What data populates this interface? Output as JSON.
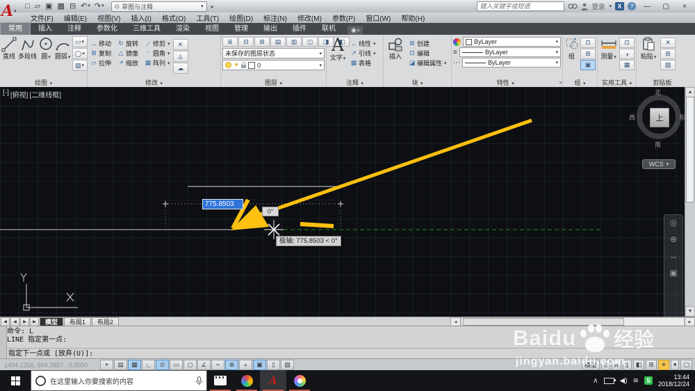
{
  "colors": {
    "acadred": "#c01b1b",
    "sel": "#2f73d8",
    "arrow": "#ffc010",
    "polar": "#1e8f1e"
  },
  "glyphs": {
    "caret": "▾",
    "expander": "»"
  },
  "titlebar": {
    "logo": "A",
    "logo_caret": "▾",
    "qat": [
      {
        "g": "□",
        "name": "new-file-button"
      },
      {
        "g": "▱",
        "name": "open-file-button"
      },
      {
        "g": "▣",
        "name": "save-button"
      },
      {
        "g": "▩",
        "name": "save-as-button"
      },
      {
        "g": "⊟",
        "name": "plot-button"
      },
      {
        "g": "↶",
        "dd": "▾",
        "name": "undo-button"
      },
      {
        "g": "↷",
        "dd": "▾",
        "name": "redo-button"
      }
    ],
    "workspace": {
      "gear": "⊙",
      "label": "草图与注释",
      "caret": "▾"
    },
    "expand": "▸",
    "search_placeholder": "键入关键字或短语",
    "signin": "登录",
    "signin_caret": "▾",
    "exchange": "X",
    "help": "?",
    "win": {
      "min": "—",
      "max": "▢",
      "close": "×"
    }
  },
  "menubar": {
    "items": [
      "文件(F)",
      "编辑(E)",
      "视图(V)",
      "插入(I)",
      "格式(O)",
      "工具(T)",
      "绘图(D)",
      "标注(N)",
      "修改(M)",
      "参数(P)",
      "窗口(W)",
      "帮助(H)"
    ]
  },
  "ribbon": {
    "tabs": [
      {
        "label": "常用",
        "active": true
      },
      {
        "label": "插入"
      },
      {
        "label": "注释"
      },
      {
        "label": "参数化"
      },
      {
        "label": "三维工具"
      },
      {
        "label": "渲染"
      },
      {
        "label": "视图"
      },
      {
        "label": "管理"
      },
      {
        "label": "输出"
      },
      {
        "label": "插件"
      },
      {
        "label": "联机"
      }
    ],
    "extra": {
      "g": "◉",
      "dd": "▾"
    },
    "draw": {
      "title": "绘图",
      "caret": "▾",
      "tools": [
        {
          "label": "直线"
        },
        {
          "label": "多段线"
        },
        {
          "label": "圆",
          "dd": "▾"
        },
        {
          "label": "圆弧",
          "dd": "▾"
        }
      ],
      "side": [
        {
          "g": "▭",
          "dd": "▾",
          "name": "rectangle-button"
        },
        {
          "g": "◯",
          "dd": "▾",
          "name": "ellipse-button"
        },
        {
          "g": "▨",
          "dd": "▾",
          "name": "hatch-button"
        }
      ]
    },
    "modify": {
      "title": "修改",
      "caret": "▾",
      "tools": [
        {
          "g": "↔",
          "label": "移动",
          "name": "move-button"
        },
        {
          "g": "⊞",
          "label": "复制",
          "name": "copy-button"
        },
        {
          "g": "▱",
          "label": "拉伸",
          "name": "stretch-button"
        },
        {
          "g": "↻",
          "label": "旋转",
          "name": "rotate-button"
        },
        {
          "g": "△",
          "label": "镜像",
          "name": "mirror-button"
        },
        {
          "g": "↗",
          "label": "缩放",
          "name": "scale-button"
        },
        {
          "g": "∕",
          "label": "修剪",
          "dd": "▾",
          "name": "trim-button"
        },
        {
          "g": "◜",
          "label": "圆角",
          "dd": "▾",
          "name": "fillet-button"
        },
        {
          "g": "▦",
          "label": "阵列",
          "dd": "▾",
          "name": "array-button"
        }
      ],
      "side": [
        {
          "g": "✕",
          "name": "erase-button"
        },
        {
          "g": "◬",
          "name": "explode-button"
        },
        {
          "g": "☁",
          "name": "revision-cloud-button"
        }
      ]
    },
    "layers": {
      "title": "图层",
      "caret": "▾",
      "row_icons": [
        {
          "g": "≣"
        },
        {
          "g": "⊟"
        },
        {
          "g": "⊞"
        },
        {
          "g": "▤"
        },
        {
          "g": "▥"
        },
        {
          "g": "◫"
        },
        {
          "g": "◨"
        },
        {
          "g": "◧"
        }
      ],
      "state": "未保存的图层状态",
      "state_caret": "▾",
      "layer_name": "0",
      "layer_caret": "▾",
      "sun": "☀"
    },
    "annotation": {
      "title": "注释",
      "caret": "▾",
      "big": "A",
      "big_label": "文字",
      "big_caret": "▾",
      "rows": [
        {
          "g": "↔",
          "label": "线性",
          "dd": "▾",
          "name": "linear-dim-button"
        },
        {
          "g": "↗",
          "label": "引线",
          "dd": "▾",
          "name": "leader-button"
        },
        {
          "g": "▦",
          "label": "表格",
          "name": "table-button"
        }
      ]
    },
    "block": {
      "title": "块",
      "caret": "▾",
      "big_label": "插入",
      "big_caret": "▾",
      "rows": [
        {
          "g": "⊞",
          "label": "创建",
          "name": "block-create-button"
        },
        {
          "g": "⊡",
          "label": "编辑",
          "name": "block-edit-button"
        },
        {
          "g": "◪",
          "label": "编辑属性",
          "dd": "▾",
          "name": "edit-attributes-button"
        }
      ]
    },
    "properties": {
      "title": "特性",
      "caret": "▾",
      "expander": "»",
      "rows": [
        {
          "label": "ByLayer",
          "caret": "▾"
        },
        {
          "label": "ByLayer",
          "caret": "▾"
        },
        {
          "label": "ByLayer",
          "caret": "▾"
        }
      ],
      "left_icons": [
        {
          "g": "≡"
        },
        {
          "g": "⋯"
        }
      ]
    },
    "group": {
      "title": "组",
      "caret": "▾",
      "big_label": "组",
      "minis": [
        {
          "g": "⊡"
        },
        {
          "g": "⊞"
        },
        {
          "g": "▣",
          "sel": true
        }
      ]
    },
    "utilities": {
      "title": "实用工具",
      "caret": "▾",
      "big_label": "测量",
      "big_caret": "▾",
      "minis": [
        {
          "g": "⊡"
        },
        {
          "g": "◑"
        },
        {
          "g": "▦"
        }
      ]
    },
    "clipboard": {
      "title": "剪贴板",
      "big_label": "粘贴",
      "big_caret": "▾",
      "minis": [
        {
          "g": "✕"
        },
        {
          "g": "⊞"
        },
        {
          "g": "▧"
        }
      ]
    }
  },
  "viewport": {
    "controls": [
      {
        "label": "[-]"
      },
      {
        "label": "[俯视]"
      },
      {
        "label": "[二维线框]"
      }
    ]
  },
  "canvas": {
    "dim_input": "775.8503",
    "angle_label": "0°",
    "tooltip": "极轴: 775.8503 < 0°",
    "viewcube": {
      "n": "北",
      "s": "南",
      "e": "东",
      "w": "西",
      "top": "上",
      "wcs": "WCS",
      "wcs_caret": "▾"
    },
    "ucs": {
      "x": "X",
      "y": "Y"
    },
    "navbar": [
      {
        "g": "◎"
      },
      {
        "g": "⊕"
      },
      {
        "g": "↔"
      },
      {
        "g": "▣"
      }
    ],
    "vscroll": {
      "up": "▲",
      "down": "▼"
    }
  },
  "tabsbar": {
    "nav": [
      {
        "g": "◀"
      },
      {
        "g": "◀"
      },
      {
        "g": "▶"
      },
      {
        "g": "▶"
      }
    ],
    "tabs": [
      {
        "label": "模型",
        "active": true
      },
      {
        "label": "布局1"
      },
      {
        "label": "布局2"
      }
    ],
    "scroll": {
      "left": "◂",
      "right": "▸"
    }
  },
  "commandline": {
    "history": [
      "命令: L",
      "LINE 指定第一点:"
    ],
    "prompt": "指定下一点或 [放弃(U)]:"
  },
  "statusbar": {
    "coords": "1494.1258, 994.3857 , 0.0000",
    "toggles": [
      {
        "g": "⌖",
        "name": "infer-constraints-toggle"
      },
      {
        "g": "▤",
        "name": "snap-mode-toggle"
      },
      {
        "g": "▦",
        "on": true,
        "name": "grid-toggle"
      },
      {
        "g": "∟",
        "name": "ortho-toggle"
      },
      {
        "g": "⊙",
        "on": true,
        "name": "polar-tracking-toggle"
      },
      {
        "g": "▭",
        "name": "isometric-drafting-toggle"
      },
      {
        "g": "◻",
        "name": "object-snap-tracking-toggle"
      },
      {
        "g": "∠",
        "name": "2d-object-snap-toggle"
      },
      {
        "g": "⌁",
        "name": "lineweight-toggle"
      },
      {
        "g": "⊕",
        "on": true,
        "name": "object-snap-toggle"
      },
      {
        "g": "+",
        "name": "selection-cycling-toggle"
      },
      {
        "g": "▣",
        "on": true,
        "name": "dynamic-input-toggle"
      },
      {
        "g": "▯",
        "name": "quick-properties-toggle"
      },
      {
        "g": "▧",
        "name": "annotation-monitor-toggle"
      }
    ],
    "model_label": "模型",
    "right_icons": [
      {
        "g": "▯"
      },
      {
        "g": "A"
      },
      {
        "g": "1"
      },
      {
        "g": "◧"
      },
      {
        "g": "⊞"
      }
    ],
    "bulb": "☀",
    "bulb_caret": "▾",
    "clean": "▢"
  },
  "taskbar": {
    "search_placeholder": "在这里输入你要搜索的内容",
    "tray_expand": "∧",
    "volume": "◀)",
    "wifi": "≋",
    "s_badge": "S",
    "time": "13:44",
    "date": "2018/12/24"
  },
  "watermark": {
    "brand": "Baidu",
    "suffix": "经验",
    "url": "jingyan.baidu.com"
  }
}
